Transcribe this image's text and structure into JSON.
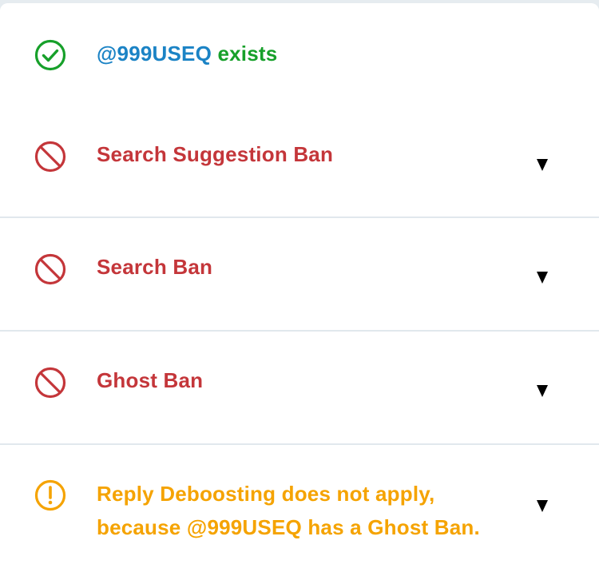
{
  "account": {
    "handle": "@999USEQ",
    "status_text": "exists"
  },
  "checks": [
    {
      "label": "Search Suggestion Ban",
      "status": "ban",
      "icon": "prohibited-icon"
    },
    {
      "label": "Search Ban",
      "status": "ban",
      "icon": "prohibited-icon"
    },
    {
      "label": "Ghost Ban",
      "status": "ban",
      "icon": "prohibited-icon"
    },
    {
      "label_line1": "Reply Deboosting does not apply,",
      "label_line2": "because @999USEQ has a Ghost Ban.",
      "status": "warning",
      "icon": "warning-icon"
    }
  ],
  "icons": {
    "exists": "check-circle-icon",
    "toggle": "triangle-down-icon"
  },
  "colors": {
    "handle": "#1b83c5",
    "ok": "#17a02a",
    "ban": "#c4363a",
    "warning": "#f5a300",
    "divider": "#e1e8ed"
  }
}
